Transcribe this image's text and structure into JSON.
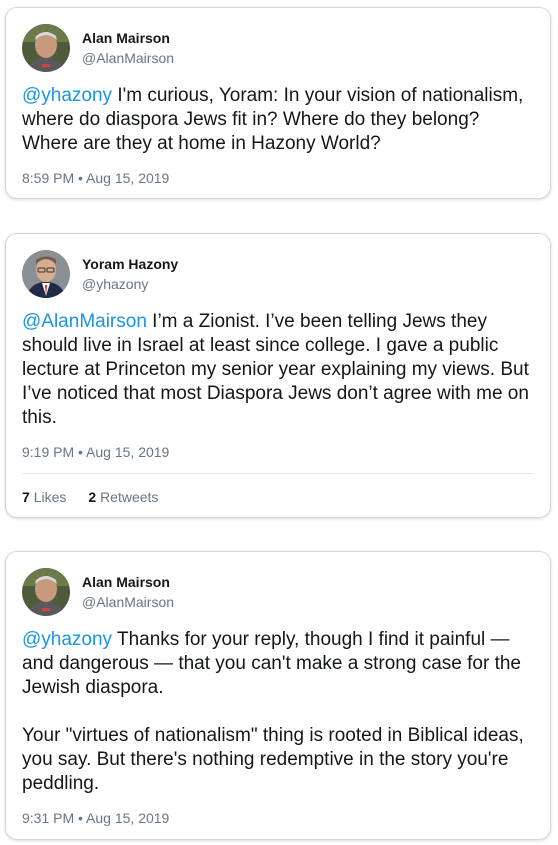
{
  "tweets": [
    {
      "name": "Alan Mairson",
      "handle": "@AlanMairson",
      "mention": "@yhazony",
      "text": " I'm curious, Yoram: In your vision of nationalism, where do diaspora Jews fit in? Where do they belong? Where are they at home in Hazony World?",
      "timestamp": "8:59 PM • Aug 15, 2019"
    },
    {
      "name": "Yoram Hazony",
      "handle": "@yhazony",
      "mention": "@AlanMairson",
      "text": " I’m a Zionist. I’ve been telling Jews they should live in Israel at least since college. I gave a public lecture at Princeton my senior year explaining my views. But I’ve noticed that most Diaspora Jews don’t agree with me on this.",
      "timestamp": "9:19 PM • Aug 15, 2019",
      "likes_count": "7",
      "likes_label": "Likes",
      "retweets_count": "2",
      "retweets_label": "Retweets"
    },
    {
      "name": "Alan Mairson",
      "handle": "@AlanMairson",
      "mention": "@yhazony",
      "text": " Thanks for your reply, though I find it painful — and dangerous — that you can't make a strong case for the Jewish diaspora.",
      "text2": "Your \"virtues of nationalism\" thing is rooted in Biblical ideas, you say. But there's nothing redemptive in the story you're peddling.",
      "timestamp": "9:31 PM • Aug 15, 2019"
    }
  ],
  "colors": {
    "mention": "#1b95e0",
    "secondary_text": "#657786",
    "primary_text": "#14171a"
  }
}
